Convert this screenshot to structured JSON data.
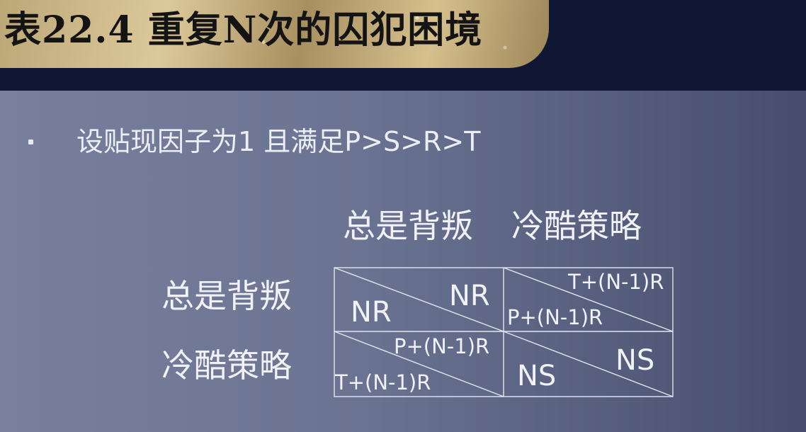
{
  "title": "表22.4  重复N次的囚犯困境",
  "bullet": "设贴现因子为1 且满足P>S>R>T",
  "matrix": {
    "col_headers": [
      "总是背叛",
      "冷酷策略"
    ],
    "row_headers": [
      "总是背叛",
      "冷酷策略"
    ],
    "cells": [
      [
        {
          "top_right": "NR",
          "bottom_left": "NR"
        },
        {
          "top_right": "T+(N-1)R",
          "bottom_left": "P+(N-1)R"
        }
      ],
      [
        {
          "top_right": "P+(N-1)R",
          "bottom_left": "T+(N-1)R"
        },
        {
          "top_right": "NS",
          "bottom_left": "NS"
        }
      ]
    ]
  },
  "colors": {
    "title_band": "#101733",
    "gold": "#cdb98a",
    "content_left": "#78809d",
    "content_right": "#464d6d",
    "text": "#f1f2f7"
  }
}
